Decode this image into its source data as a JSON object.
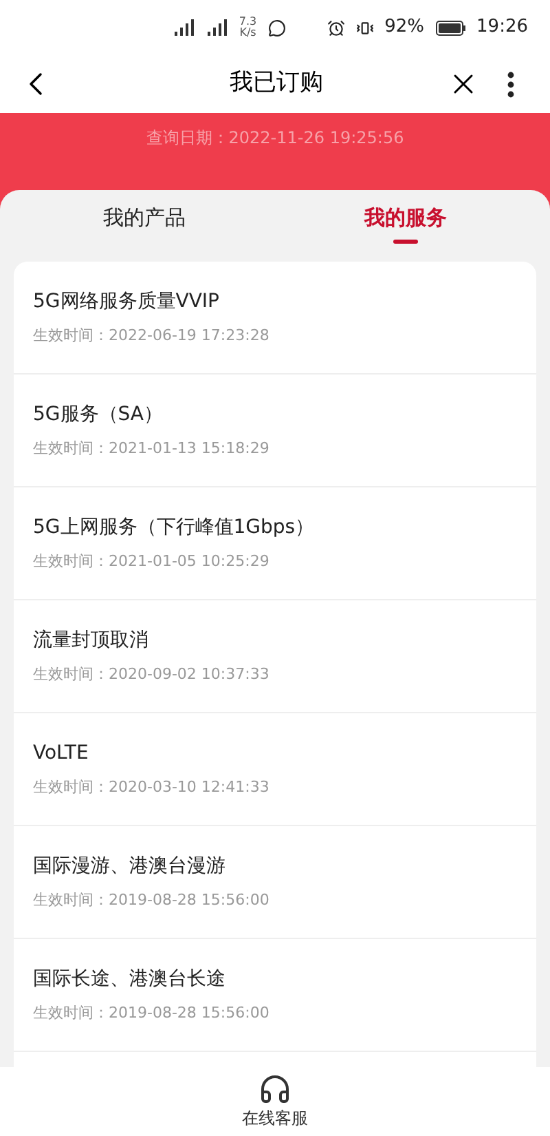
{
  "status_bar": {
    "net_speed": "7.3",
    "net_speed_unit": "K/s",
    "battery": "92%",
    "time": "19:26"
  },
  "header": {
    "title": "我已订购"
  },
  "banner": {
    "query_date": "查询日期：2022-11-26 19:25:56"
  },
  "tabs": [
    {
      "label": "我的产品",
      "selected": false
    },
    {
      "label": "我的服务",
      "selected": true
    }
  ],
  "services": [
    {
      "name": "5G网络服务质量VVIP",
      "effective": "生效时间：2022-06-19 17:23:28"
    },
    {
      "name": "5G服务（SA）",
      "effective": "生效时间：2021-01-13 15:18:29"
    },
    {
      "name": "5G上网服务（下行峰值1Gbps）",
      "effective": "生效时间：2021-01-05 10:25:29"
    },
    {
      "name": "流量封顶取消",
      "effective": "生效时间：2020-09-02 10:37:33"
    },
    {
      "name": "VoLTE",
      "effective": "生效时间：2020-03-10 12:41:33"
    },
    {
      "name": "国际漫游、港澳台漫游",
      "effective": "生效时间：2019-08-28 15:56:00"
    },
    {
      "name": "国际长途、港澳台长途",
      "effective": "生效时间：2019-08-28 15:56:00"
    }
  ],
  "bottom_bar": {
    "label": "在线客服"
  }
}
